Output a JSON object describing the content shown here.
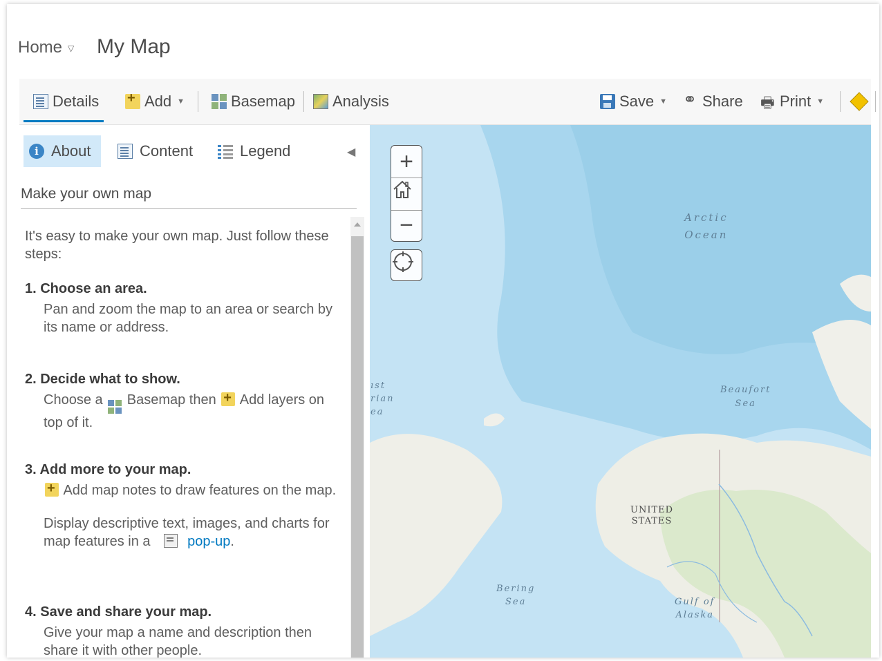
{
  "header": {
    "home_label": "Home",
    "map_title": "My Map"
  },
  "toolbar": {
    "details": "Details",
    "add": "Add",
    "basemap": "Basemap",
    "analysis": "Analysis",
    "save": "Save",
    "share": "Share",
    "print": "Print"
  },
  "panel": {
    "tabs": [
      "About",
      "Content",
      "Legend"
    ],
    "heading": "Make your own map",
    "intro": "It's easy to make your own map. Just follow these steps:",
    "steps": [
      {
        "title": "1. Choose an area.",
        "body": "Pan and zoom the map to an area or search by its name or address."
      },
      {
        "title": "2. Decide what to show.",
        "body_a": "Choose a",
        "body_b": "Basemap then",
        "body_c": "Add layers on top of it."
      },
      {
        "title": "3. Add more to your map.",
        "body": "Add map notes to draw features on the map.",
        "body2_a": "Display descriptive text, images, and charts for map features in a",
        "body2_link": "pop-up",
        "body2_end": "."
      },
      {
        "title": "4. Save and share your map.",
        "body": "Give your map a name and description then share it with other people."
      }
    ]
  },
  "map": {
    "labels": {
      "arctic_ocean": [
        "Arctic",
        "Ocean"
      ],
      "beaufort_sea": [
        "Beaufort",
        "Sea"
      ],
      "bering_sea": [
        "Bering",
        "Sea"
      ],
      "gulf_of_alaska": [
        "Gulf of",
        "Alaska"
      ],
      "united_states": [
        "UNITED",
        "STATES"
      ],
      "east_siberian_sea_partial": [
        "ıst",
        "rian",
        "ea"
      ]
    },
    "colors": {
      "deep_water": "#9fd2ec",
      "water": "#bfe0f3",
      "land": "#f0f0ea",
      "vegetation": "#d7e8c8"
    }
  },
  "icons": [
    "details-icon",
    "add-icon",
    "basemap-icon",
    "analysis-icon",
    "save-icon",
    "share-icon",
    "print-icon",
    "directions-icon",
    "info-icon",
    "content-icon",
    "legend-icon",
    "home-icon",
    "locate-icon"
  ]
}
